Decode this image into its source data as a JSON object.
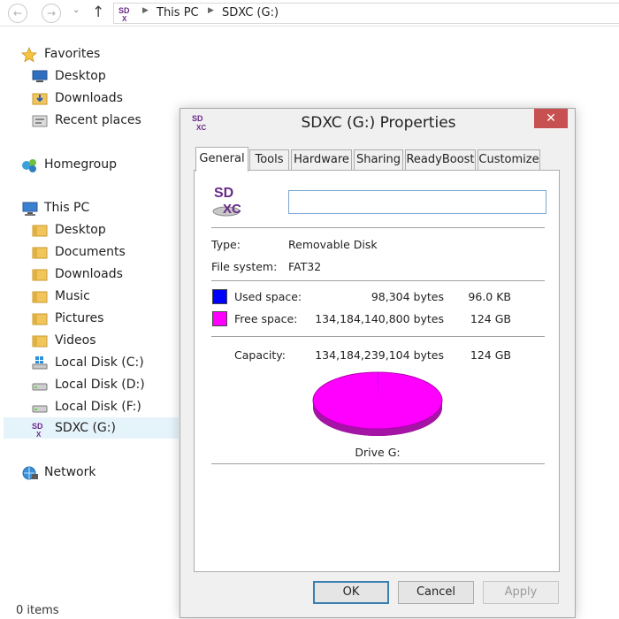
{
  "address_bar": {
    "breadcrumbs": [
      "This PC",
      "SDXC (G:)"
    ],
    "back_icon": "back-arrow-icon",
    "forward_icon": "forward-arrow-icon",
    "recent_icon": "chevron-down-icon",
    "up_icon": "up-arrow-icon"
  },
  "nav_pane": {
    "favorites": {
      "label": "Favorites",
      "items": [
        {
          "label": "Desktop",
          "icon": "desktop-icon"
        },
        {
          "label": "Downloads",
          "icon": "downloads-folder-icon"
        },
        {
          "label": "Recent places",
          "icon": "recent-places-icon"
        }
      ]
    },
    "homegroup": {
      "label": "Homegroup"
    },
    "this_pc": {
      "label": "This PC",
      "items": [
        {
          "label": "Desktop",
          "icon": "folder-icon"
        },
        {
          "label": "Documents",
          "icon": "folder-icon"
        },
        {
          "label": "Downloads",
          "icon": "folder-icon"
        },
        {
          "label": "Music",
          "icon": "folder-icon"
        },
        {
          "label": "Pictures",
          "icon": "folder-icon"
        },
        {
          "label": "Videos",
          "icon": "folder-icon"
        },
        {
          "label": "Local Disk (C:)",
          "icon": "windows-drive-icon"
        },
        {
          "label": "Local Disk (D:)",
          "icon": "drive-icon"
        },
        {
          "label": "Local Disk (F:)",
          "icon": "drive-icon"
        },
        {
          "label": "SDXC (G:)",
          "icon": "sdxc-icon",
          "selected": true
        }
      ]
    },
    "network": {
      "label": "Network"
    }
  },
  "status_bar": {
    "text": "0 items"
  },
  "dialog": {
    "title": "SDXC (G:) Properties",
    "close_glyph": "✕",
    "tabs": [
      "General",
      "Tools",
      "Hardware",
      "Sharing",
      "ReadyBoost",
      "Customize"
    ],
    "active_tab": "General",
    "drive_icon_text": {
      "top": "SD",
      "bottom": "XC"
    },
    "name_value": "",
    "type_label": "Type:",
    "type_value": "Removable Disk",
    "fs_label": "File system:",
    "fs_value": "FAT32",
    "used": {
      "label": "Used space:",
      "bytes": "98,304 bytes",
      "size": "96.0 KB",
      "color": "#0000ff"
    },
    "free": {
      "label": "Free space:",
      "bytes": "134,184,140,800 bytes",
      "size": "124 GB",
      "color": "#ff00ff"
    },
    "capacity": {
      "label": "Capacity:",
      "bytes": "134,184,239,104 bytes",
      "size": "124 GB"
    },
    "drive_label": "Drive G:",
    "used_fraction": 7e-07,
    "buttons": {
      "ok": "OK",
      "cancel": "Cancel",
      "apply": "Apply"
    }
  }
}
